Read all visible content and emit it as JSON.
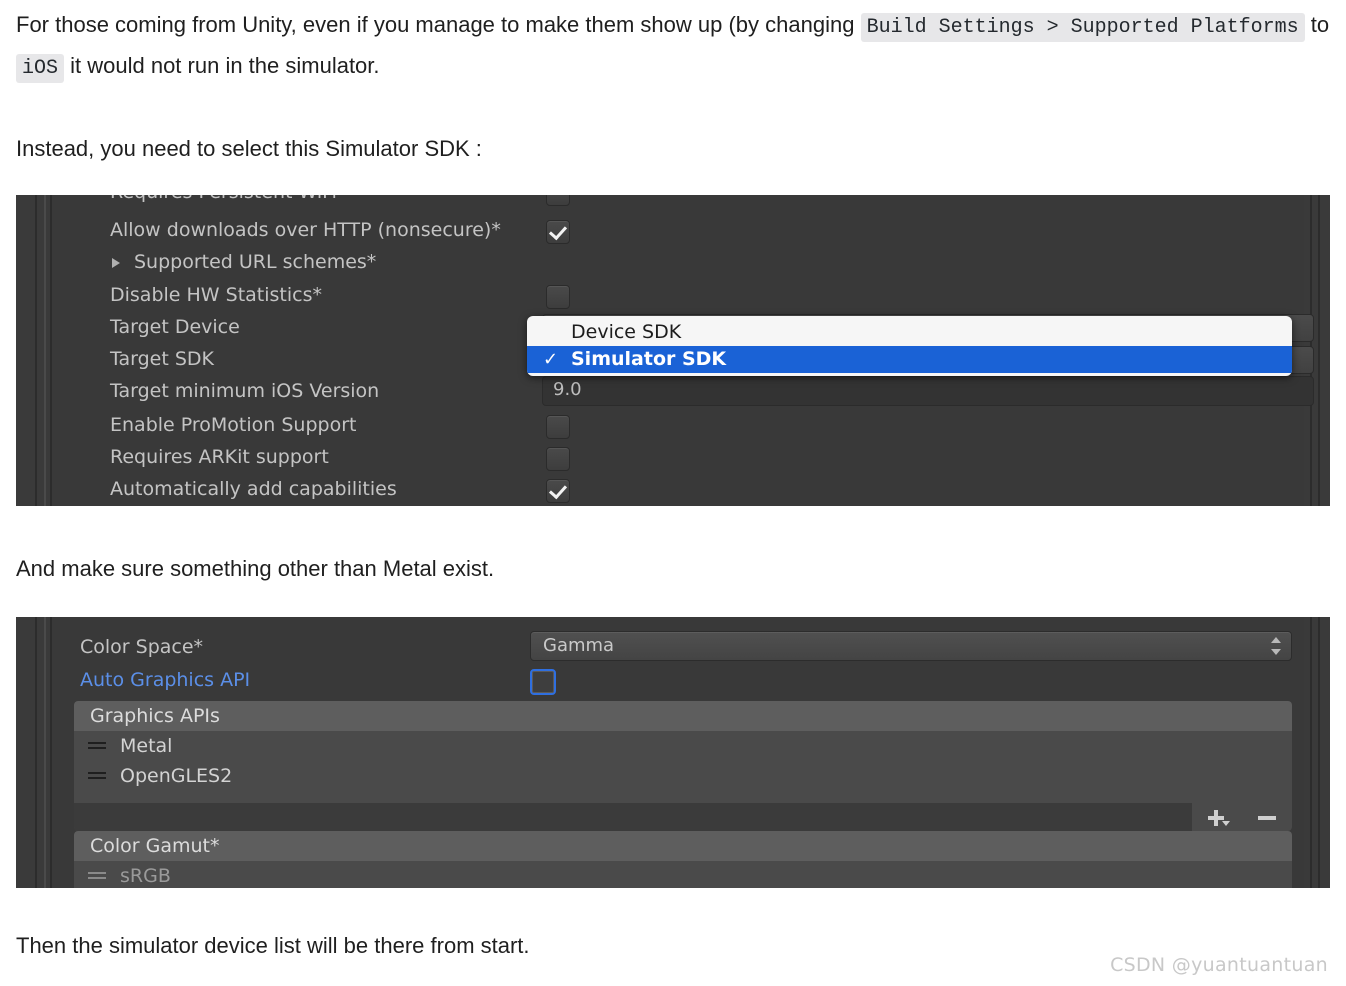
{
  "article": {
    "para1": {
      "seg1": "For those coming from Unity, even if you manage to make them show up (by changing ",
      "code1": "Build Settings > Supported Platforms",
      "seg2": " to ",
      "code2": "iOS",
      "seg3": " it would not run in the simulator."
    },
    "para2": "Instead, you need to select this Simulator SDK :",
    "para3": "And make sure something other than Metal exist.",
    "para4": "Then the simulator device list will be there from start."
  },
  "ios_panel": {
    "rows": [
      {
        "label": "Requires Persistent WiFi",
        "control": "checkbox",
        "checked": false,
        "clipped": true
      },
      {
        "label": "Allow downloads over HTTP (nonsecure)*",
        "control": "checkbox",
        "checked": true
      },
      {
        "label": "Supported URL schemes*",
        "control": "foldout"
      },
      {
        "label": "Disable HW Statistics*",
        "control": "checkbox",
        "checked": false
      },
      {
        "label": "Target Device",
        "control": "popup",
        "value": ""
      },
      {
        "label": "Target SDK",
        "control": "popup",
        "value": ""
      },
      {
        "label": "Target minimum iOS Version",
        "control": "text",
        "value": "9.0"
      },
      {
        "label": "Enable ProMotion Support",
        "control": "checkbox",
        "checked": false
      },
      {
        "label": "Requires ARKit support",
        "control": "checkbox",
        "checked": false
      },
      {
        "label": "Automatically add capabilities",
        "control": "checkbox",
        "checked": true
      }
    ],
    "dropdown": {
      "options": [
        {
          "label": "Device SDK",
          "selected": false
        },
        {
          "label": "Simulator SDK",
          "selected": true
        }
      ],
      "checkmark": "✓",
      "highlight_color": "#1a62d6"
    }
  },
  "graphics_panel": {
    "color_space": {
      "label": "Color Space*",
      "value": "Gamma"
    },
    "auto_graphics_api": {
      "label": "Auto Graphics API",
      "checked": false,
      "color": "#5b8fe8"
    },
    "graphics_apis": {
      "header": "Graphics APIs",
      "items": [
        "Metal",
        "OpenGLES2"
      ],
      "add_button": "+",
      "remove_button": "−"
    },
    "color_gamut": {
      "header": "Color Gamut*",
      "items": [
        "sRGB"
      ]
    }
  },
  "watermark": "CSDN @yuantuantuan"
}
